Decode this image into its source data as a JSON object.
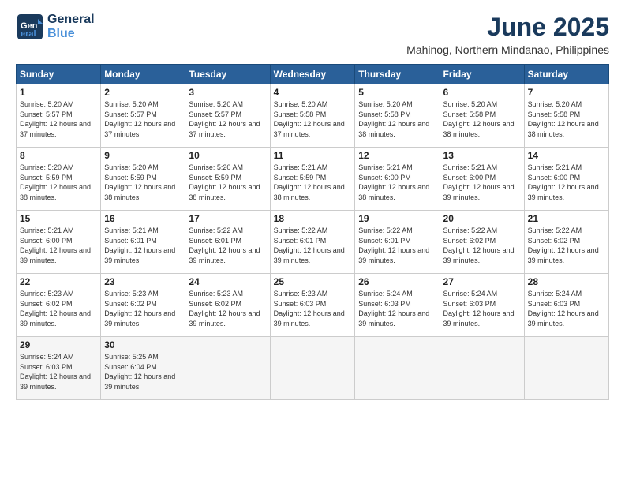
{
  "logo": {
    "line1": "General",
    "line2": "Blue"
  },
  "title": "June 2025",
  "subtitle": "Mahinog, Northern Mindanao, Philippines",
  "weekdays": [
    "Sunday",
    "Monday",
    "Tuesday",
    "Wednesday",
    "Thursday",
    "Friday",
    "Saturday"
  ],
  "weeks": [
    [
      {
        "day": "1",
        "sunrise": "5:20 AM",
        "sunset": "5:57 PM",
        "daylight": "12 hours and 37 minutes."
      },
      {
        "day": "2",
        "sunrise": "5:20 AM",
        "sunset": "5:57 PM",
        "daylight": "12 hours and 37 minutes."
      },
      {
        "day": "3",
        "sunrise": "5:20 AM",
        "sunset": "5:57 PM",
        "daylight": "12 hours and 37 minutes."
      },
      {
        "day": "4",
        "sunrise": "5:20 AM",
        "sunset": "5:58 PM",
        "daylight": "12 hours and 37 minutes."
      },
      {
        "day": "5",
        "sunrise": "5:20 AM",
        "sunset": "5:58 PM",
        "daylight": "12 hours and 38 minutes."
      },
      {
        "day": "6",
        "sunrise": "5:20 AM",
        "sunset": "5:58 PM",
        "daylight": "12 hours and 38 minutes."
      },
      {
        "day": "7",
        "sunrise": "5:20 AM",
        "sunset": "5:58 PM",
        "daylight": "12 hours and 38 minutes."
      }
    ],
    [
      {
        "day": "8",
        "sunrise": "5:20 AM",
        "sunset": "5:59 PM",
        "daylight": "12 hours and 38 minutes."
      },
      {
        "day": "9",
        "sunrise": "5:20 AM",
        "sunset": "5:59 PM",
        "daylight": "12 hours and 38 minutes."
      },
      {
        "day": "10",
        "sunrise": "5:20 AM",
        "sunset": "5:59 PM",
        "daylight": "12 hours and 38 minutes."
      },
      {
        "day": "11",
        "sunrise": "5:21 AM",
        "sunset": "5:59 PM",
        "daylight": "12 hours and 38 minutes."
      },
      {
        "day": "12",
        "sunrise": "5:21 AM",
        "sunset": "6:00 PM",
        "daylight": "12 hours and 38 minutes."
      },
      {
        "day": "13",
        "sunrise": "5:21 AM",
        "sunset": "6:00 PM",
        "daylight": "12 hours and 39 minutes."
      },
      {
        "day": "14",
        "sunrise": "5:21 AM",
        "sunset": "6:00 PM",
        "daylight": "12 hours and 39 minutes."
      }
    ],
    [
      {
        "day": "15",
        "sunrise": "5:21 AM",
        "sunset": "6:00 PM",
        "daylight": "12 hours and 39 minutes."
      },
      {
        "day": "16",
        "sunrise": "5:21 AM",
        "sunset": "6:01 PM",
        "daylight": "12 hours and 39 minutes."
      },
      {
        "day": "17",
        "sunrise": "5:22 AM",
        "sunset": "6:01 PM",
        "daylight": "12 hours and 39 minutes."
      },
      {
        "day": "18",
        "sunrise": "5:22 AM",
        "sunset": "6:01 PM",
        "daylight": "12 hours and 39 minutes."
      },
      {
        "day": "19",
        "sunrise": "5:22 AM",
        "sunset": "6:01 PM",
        "daylight": "12 hours and 39 minutes."
      },
      {
        "day": "20",
        "sunrise": "5:22 AM",
        "sunset": "6:02 PM",
        "daylight": "12 hours and 39 minutes."
      },
      {
        "day": "21",
        "sunrise": "5:22 AM",
        "sunset": "6:02 PM",
        "daylight": "12 hours and 39 minutes."
      }
    ],
    [
      {
        "day": "22",
        "sunrise": "5:23 AM",
        "sunset": "6:02 PM",
        "daylight": "12 hours and 39 minutes."
      },
      {
        "day": "23",
        "sunrise": "5:23 AM",
        "sunset": "6:02 PM",
        "daylight": "12 hours and 39 minutes."
      },
      {
        "day": "24",
        "sunrise": "5:23 AM",
        "sunset": "6:02 PM",
        "daylight": "12 hours and 39 minutes."
      },
      {
        "day": "25",
        "sunrise": "5:23 AM",
        "sunset": "6:03 PM",
        "daylight": "12 hours and 39 minutes."
      },
      {
        "day": "26",
        "sunrise": "5:24 AM",
        "sunset": "6:03 PM",
        "daylight": "12 hours and 39 minutes."
      },
      {
        "day": "27",
        "sunrise": "5:24 AM",
        "sunset": "6:03 PM",
        "daylight": "12 hours and 39 minutes."
      },
      {
        "day": "28",
        "sunrise": "5:24 AM",
        "sunset": "6:03 PM",
        "daylight": "12 hours and 39 minutes."
      }
    ],
    [
      {
        "day": "29",
        "sunrise": "5:24 AM",
        "sunset": "6:03 PM",
        "daylight": "12 hours and 39 minutes."
      },
      {
        "day": "30",
        "sunrise": "5:25 AM",
        "sunset": "6:04 PM",
        "daylight": "12 hours and 39 minutes."
      },
      null,
      null,
      null,
      null,
      null
    ]
  ]
}
